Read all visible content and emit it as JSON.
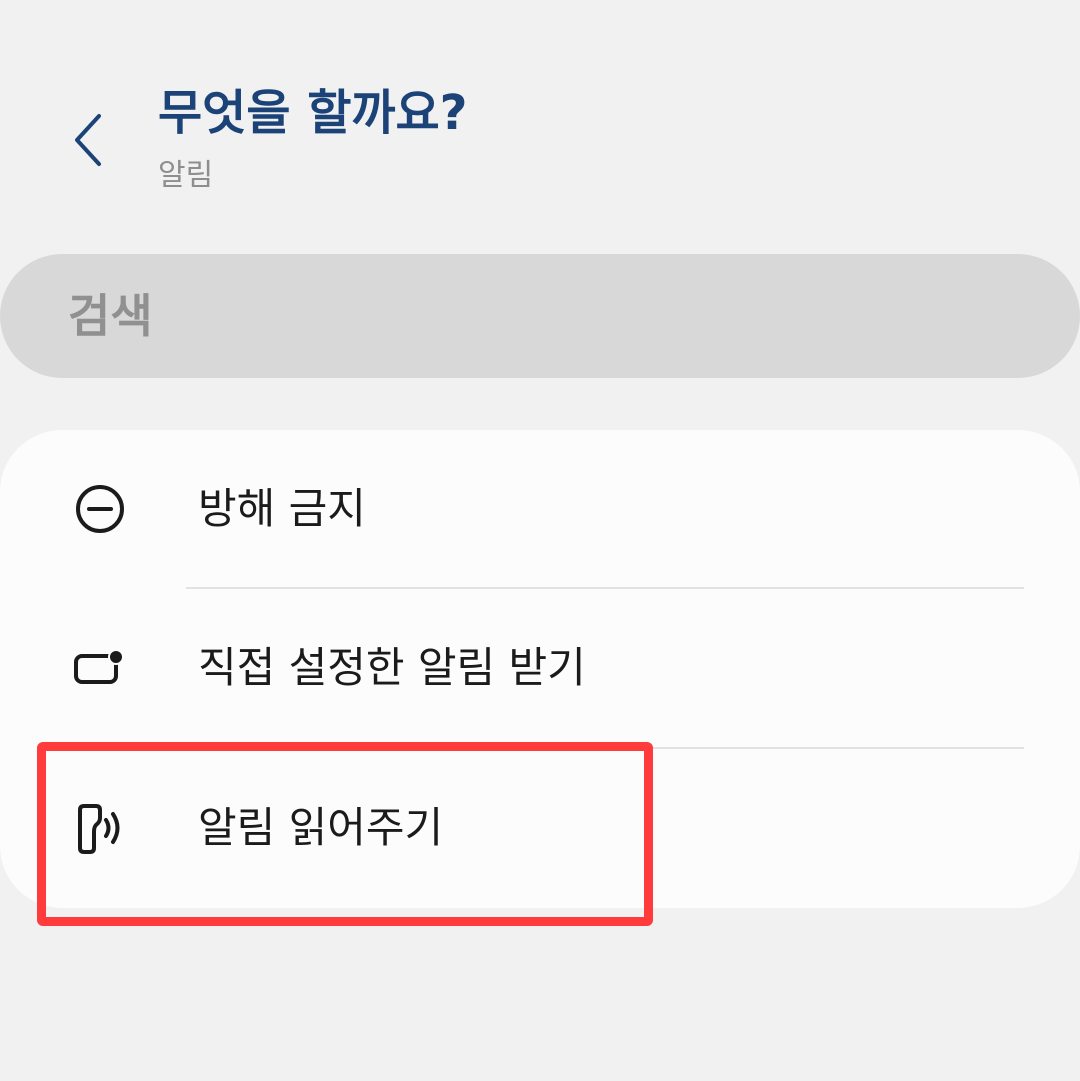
{
  "header": {
    "title": "무엇을 할까요?",
    "subtitle": "알림"
  },
  "search": {
    "placeholder": "검색"
  },
  "menu": {
    "items": [
      {
        "label": "방해 금지",
        "icon": "do-not-disturb-icon"
      },
      {
        "label": "직접 설정한 알림 받기",
        "icon": "notification-dot-icon"
      },
      {
        "label": "알림 읽어주기",
        "icon": "read-aloud-icon"
      }
    ]
  },
  "colors": {
    "background": "#f1f1f1",
    "title": "#1c4378",
    "highlight": "#ff3b3b",
    "card": "#fcfcfc",
    "search_bg": "#d8d8d8"
  }
}
